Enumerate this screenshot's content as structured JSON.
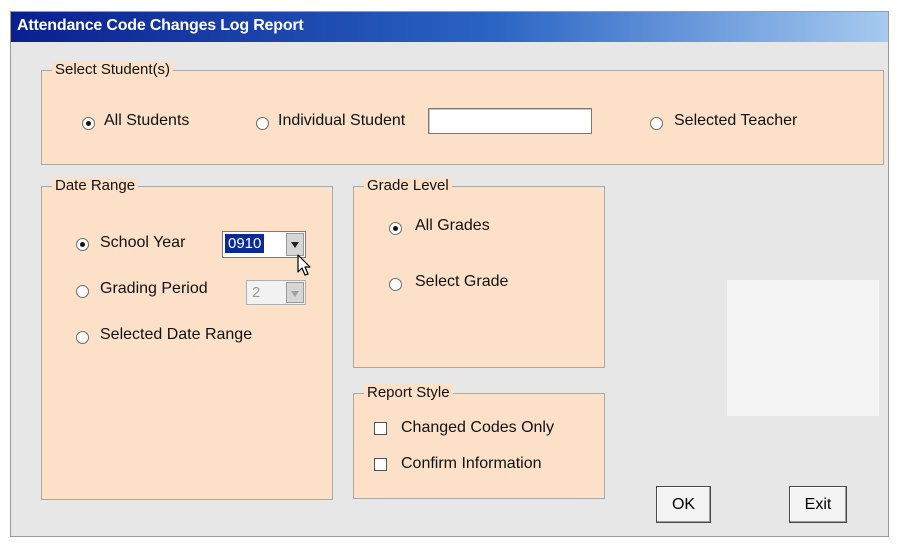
{
  "window": {
    "title": "Attendance Code Changes Log Report"
  },
  "select_students": {
    "legend": "Select Student(s)",
    "all_students": "All Students",
    "individual_student": "Individual Student",
    "individual_value": "",
    "selected_teacher": "Selected Teacher",
    "selected": "all_students"
  },
  "date_range": {
    "legend": "Date Range",
    "school_year": "School Year",
    "school_year_value": "0910",
    "grading_period": "Grading Period",
    "grading_period_value": "2",
    "selected_date_range": "Selected Date Range",
    "selected": "school_year"
  },
  "grade_level": {
    "legend": "Grade Level",
    "all_grades": "All Grades",
    "select_grade": "Select Grade",
    "selected": "all_grades"
  },
  "report_style": {
    "legend": "Report Style",
    "changed_codes_only": "Changed Codes Only",
    "confirm_information": "Confirm Information"
  },
  "buttons": {
    "ok": "OK",
    "exit": "Exit"
  },
  "icons": {
    "cursor": "arrow-cursor-icon"
  },
  "colors": {
    "title_bar": "#0a1f8f",
    "group_bg": "#fde0c8",
    "selection": "#0a2a9a"
  }
}
